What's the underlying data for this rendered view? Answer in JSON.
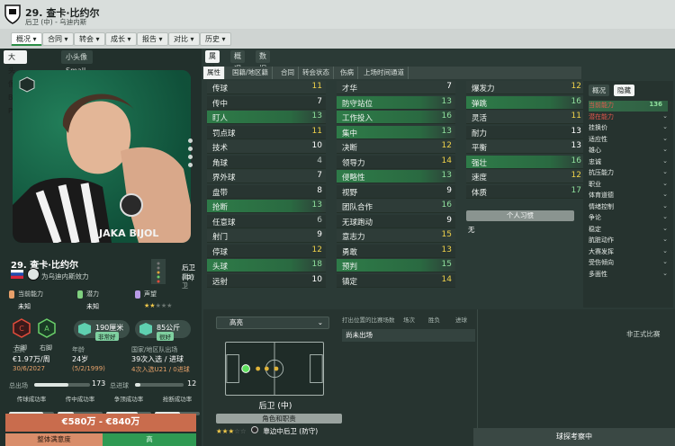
{
  "header": {
    "title": "29. 查卡·比约尔",
    "subtitle": "后卫 (中) - 乌迪内斯"
  },
  "menu": {
    "items": [
      "概况",
      "合同",
      "转会",
      "成长",
      "报告",
      "对比",
      "历史"
    ]
  },
  "left": {
    "image_tabs": [
      "大头像 Big-Pic",
      "小头像 Small-Pic"
    ],
    "portrait_text": "JAKA BIJOL",
    "player_name": "29. 查卡·比约尔",
    "club_line": "为乌迪内斯效力",
    "position_main": "后卫 (中)",
    "position_sub": "靠边卫",
    "abilities": [
      {
        "label": "当前能力",
        "value": "未知",
        "color": "#e8a06a"
      },
      {
        "label": "潜力",
        "value": "未知",
        "color": "#7fd07f"
      },
      {
        "label": "声望",
        "stars": 2,
        "max_stars": 5,
        "color": "#b89ae6"
      }
    ],
    "foot_left": {
      "label": "左脚",
      "letter": "C"
    },
    "foot_right": {
      "label": "右脚",
      "letter": "A"
    },
    "height": {
      "value": "190厘米",
      "rating": "非常好"
    },
    "weight": {
      "value": "85公斤",
      "rating": "很好"
    },
    "info": {
      "wage_h": "工资",
      "wage_v": "€1.97万/周",
      "wage_date": "30/6/2027",
      "age_h": "年龄",
      "age_v": "24岁",
      "age_dob": "(5/2/1999)",
      "caps_h": "国家/地区队出场",
      "caps_v": "39次入选 / 进球",
      "caps_sub": "4次入选U21 / 0进球"
    },
    "apps": {
      "label": "总出场",
      "value": "173",
      "fill": 0.62
    },
    "goals": {
      "label": "总进球",
      "value": "12",
      "fill": 0.12
    },
    "traits": [
      {
        "label": "传球成功率",
        "fill": 0.75
      },
      {
        "label": "传中成功率",
        "fill": 0.35
      },
      {
        "label": "争顶成功率",
        "fill": 0.7
      },
      {
        "label": "抢断成功率",
        "fill": 0.55
      }
    ],
    "value_range": "€580万 - €840万",
    "satisfaction_label": "整体满意度",
    "satisfaction_value": "高"
  },
  "right": {
    "top_tabs": [
      "属性",
      "概况",
      "数据"
    ],
    "attr_tabs": [
      "属性",
      "国籍/地区籍",
      "合同",
      "转会状态",
      "伤病",
      "上场时间通道"
    ],
    "col1": [
      {
        "n": "传球",
        "v": "11",
        "c": "yel",
        "hl": false
      },
      {
        "n": "传中",
        "v": "7",
        "c": "",
        "hl": false
      },
      {
        "n": "盯人",
        "v": "13",
        "c": "grn",
        "hl": true
      },
      {
        "n": "罚点球",
        "v": "11",
        "c": "yel",
        "hl": false
      },
      {
        "n": "技术",
        "v": "10",
        "c": "",
        "hl": false
      },
      {
        "n": "角球",
        "v": "4",
        "c": "gry",
        "hl": false
      },
      {
        "n": "界外球",
        "v": "7",
        "c": "",
        "hl": false
      },
      {
        "n": "盘带",
        "v": "8",
        "c": "",
        "hl": false
      },
      {
        "n": "抢断",
        "v": "13",
        "c": "grn",
        "hl": true
      },
      {
        "n": "任意球",
        "v": "6",
        "c": "gry",
        "hl": false
      },
      {
        "n": "射门",
        "v": "9",
        "c": "",
        "hl": false
      },
      {
        "n": "停球",
        "v": "12",
        "c": "yel",
        "hl": false
      },
      {
        "n": "头球",
        "v": "18",
        "c": "grn",
        "hl": true
      },
      {
        "n": "远射",
        "v": "10",
        "c": "",
        "hl": false
      }
    ],
    "col2": [
      {
        "n": "才华",
        "v": "7",
        "c": "",
        "hl": false
      },
      {
        "n": "防守站位",
        "v": "13",
        "c": "grn",
        "hl": true
      },
      {
        "n": "工作投入",
        "v": "16",
        "c": "grn",
        "hl": true
      },
      {
        "n": "集中",
        "v": "13",
        "c": "grn",
        "hl": true
      },
      {
        "n": "决断",
        "v": "12",
        "c": "yel",
        "hl": false
      },
      {
        "n": "领导力",
        "v": "14",
        "c": "yel",
        "hl": false
      },
      {
        "n": "侵略性",
        "v": "13",
        "c": "grn",
        "hl": true
      },
      {
        "n": "视野",
        "v": "9",
        "c": "",
        "hl": false
      },
      {
        "n": "团队合作",
        "v": "16",
        "c": "grn",
        "hl": false
      },
      {
        "n": "无球跑动",
        "v": "9",
        "c": "",
        "hl": false
      },
      {
        "n": "意志力",
        "v": "15",
        "c": "yel",
        "hl": false
      },
      {
        "n": "勇敢",
        "v": "13",
        "c": "yel",
        "hl": false
      },
      {
        "n": "预判",
        "v": "15",
        "c": "grn",
        "hl": true
      },
      {
        "n": "镇定",
        "v": "14",
        "c": "yel",
        "hl": false
      }
    ],
    "col3": [
      {
        "n": "爆发力",
        "v": "12",
        "c": "yel",
        "hl": false
      },
      {
        "n": "弹跳",
        "v": "16",
        "c": "grn",
        "hl": true
      },
      {
        "n": "灵活",
        "v": "11",
        "c": "yel",
        "hl": false
      },
      {
        "n": "耐力",
        "v": "13",
        "c": "",
        "hl": false
      },
      {
        "n": "平衡",
        "v": "13",
        "c": "",
        "hl": false
      },
      {
        "n": "强壮",
        "v": "16",
        "c": "grn",
        "hl": true
      },
      {
        "n": "速度",
        "v": "12",
        "c": "yel",
        "hl": false
      },
      {
        "n": "体质",
        "v": "17",
        "c": "grn",
        "hl": false
      }
    ],
    "traits_button": "个人习惯",
    "traits_value": "无",
    "side_tabs": [
      "概况",
      "隐藏"
    ],
    "side_rows": [
      {
        "n": "当前能力",
        "v": "136",
        "t": "hlr"
      },
      {
        "n": "潜在能力",
        "v": "",
        "t": "red"
      },
      {
        "n": "挂换价",
        "v": "",
        "t": ""
      },
      {
        "n": "适应性",
        "v": "",
        "t": ""
      },
      {
        "n": "雄心",
        "v": "",
        "t": ""
      },
      {
        "n": "忠诚",
        "v": "",
        "t": ""
      },
      {
        "n": "抗压能力",
        "v": "",
        "t": ""
      },
      {
        "n": "职业",
        "v": "",
        "t": ""
      },
      {
        "n": "体育道德",
        "v": "",
        "t": ""
      },
      {
        "n": "情绪控制",
        "v": "",
        "t": ""
      },
      {
        "n": "争论",
        "v": "",
        "t": ""
      },
      {
        "n": "稳定",
        "v": "",
        "t": ""
      },
      {
        "n": "肮脏动作",
        "v": "",
        "t": ""
      },
      {
        "n": "大赛发挥",
        "v": "",
        "t": ""
      },
      {
        "n": "受伤倾向",
        "v": "",
        "t": ""
      },
      {
        "n": "多面性",
        "v": "",
        "t": ""
      }
    ]
  },
  "bottom": {
    "highlight_dropdown": "高亮",
    "position_label": "后卫 (中)",
    "roles_button": "角色和职责",
    "role_stars": 3,
    "role_name": "靠边中后卫 (防守)",
    "history_headers": [
      "打出位置的比赛场数",
      "场次",
      "胜负",
      "进球"
    ],
    "history_value": "尚未出场",
    "friendly_label": "非正式比赛",
    "scout_label": "球探考察中"
  },
  "colors": {
    "accent_green": "#2e7b48",
    "value_orange": "#c96c4d",
    "satisfaction_green": "#2f9a53"
  }
}
